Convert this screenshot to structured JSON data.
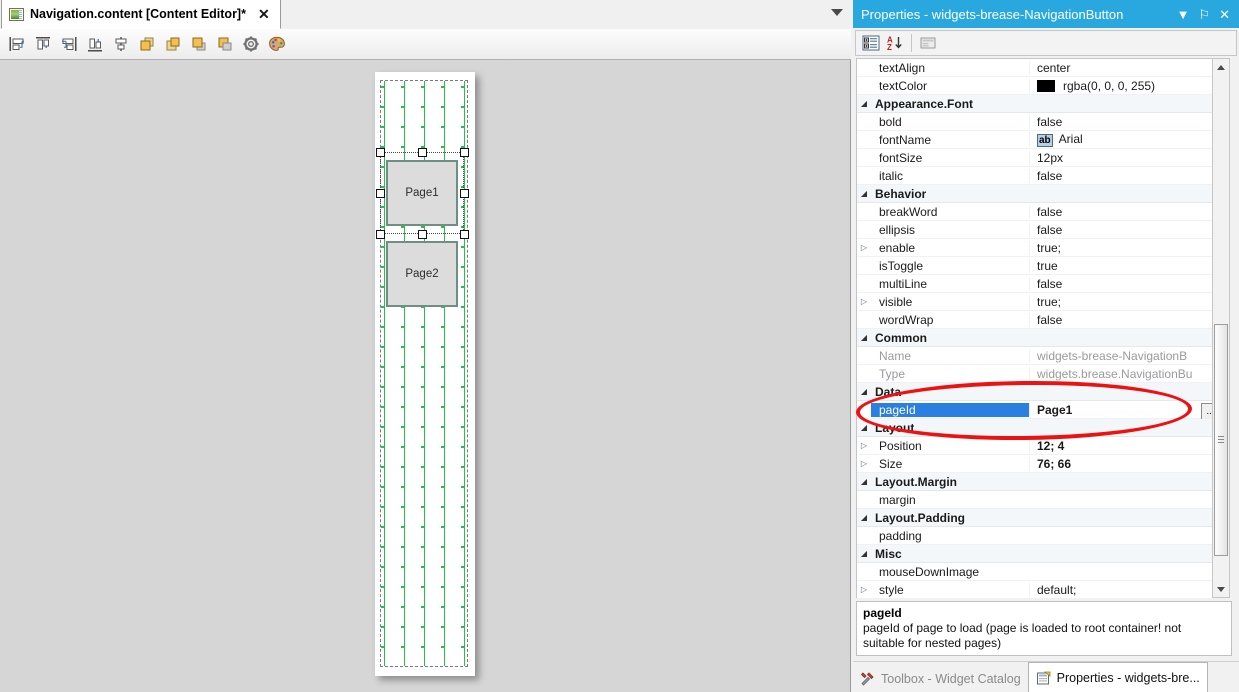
{
  "editor": {
    "tab": {
      "icon": "content-document-icon",
      "title": "Navigation.content [Content Editor]*",
      "close": "✕"
    },
    "tabstrip_dropdown_icon": "chevron-down-icon",
    "toolbar": [
      {
        "name": "align-left-button",
        "label": "Align Left"
      },
      {
        "name": "align-top-button",
        "label": "Align Top"
      },
      {
        "name": "align-right-button",
        "label": "Align Right"
      },
      {
        "name": "align-bottom-button",
        "label": "Align Bottom"
      },
      {
        "name": "align-center-button",
        "label": "Align Center"
      },
      {
        "name": "bring-to-front-button",
        "label": "Bring To Front"
      },
      {
        "name": "send-to-back-button",
        "label": "Send To Back"
      },
      {
        "name": "bring-forward-button",
        "label": "Bring Forward"
      },
      {
        "name": "send-backward-button",
        "label": "Send Backward"
      },
      {
        "name": "settings-gear-button",
        "label": "Settings"
      },
      {
        "name": "palette-button",
        "label": "Theme Palette"
      }
    ],
    "canvas": {
      "widgets": [
        {
          "label": "Page1",
          "selected": true
        },
        {
          "label": "Page2",
          "selected": false
        }
      ]
    }
  },
  "properties": {
    "title": "Properties - widgets-brease-NavigationButton",
    "title_buttons": [
      {
        "name": "panel-menu-icon",
        "glyph": "▼"
      },
      {
        "name": "pin-icon",
        "glyph": "⚐"
      },
      {
        "name": "close-icon",
        "glyph": "✕"
      }
    ],
    "toolbar": [
      {
        "name": "categorized-view-button",
        "label": "Categorized"
      },
      {
        "name": "alphabetical-sort-button",
        "label": "Alphabetical"
      },
      {
        "name": "property-pages-button",
        "label": "Property Pages"
      }
    ],
    "rows": [
      {
        "kind": "prop",
        "name": "textAlign",
        "value": "center"
      },
      {
        "kind": "prop",
        "name": "textColor",
        "value": "rgba(0, 0, 0, 255)",
        "swatch": "#000000"
      },
      {
        "kind": "category",
        "name": "Appearance.Font",
        "value": ""
      },
      {
        "kind": "prop",
        "name": "bold",
        "value": "false"
      },
      {
        "kind": "prop",
        "name": "fontName",
        "value": "Arial",
        "badge": "ab"
      },
      {
        "kind": "prop",
        "name": "fontSize",
        "value": "12px"
      },
      {
        "kind": "prop",
        "name": "italic",
        "value": "false"
      },
      {
        "kind": "category",
        "name": "Behavior",
        "value": ""
      },
      {
        "kind": "prop",
        "name": "breakWord",
        "value": "false"
      },
      {
        "kind": "prop",
        "name": "ellipsis",
        "value": "false"
      },
      {
        "kind": "prop",
        "name": "enable",
        "value": "true;",
        "expandable": true
      },
      {
        "kind": "prop",
        "name": "isToggle",
        "value": "true"
      },
      {
        "kind": "prop",
        "name": "multiLine",
        "value": "false"
      },
      {
        "kind": "prop",
        "name": "visible",
        "value": "true;",
        "expandable": true
      },
      {
        "kind": "prop",
        "name": "wordWrap",
        "value": "false"
      },
      {
        "kind": "category",
        "name": "Common",
        "value": ""
      },
      {
        "kind": "prop",
        "name": "Name",
        "value": "widgets-brease-NavigationB",
        "readonly": true
      },
      {
        "kind": "prop",
        "name": "Type",
        "value": "widgets.brease.NavigationBu",
        "readonly": true
      },
      {
        "kind": "category",
        "name": "Data",
        "value": ""
      },
      {
        "kind": "prop",
        "name": "pageId",
        "value": "Page1",
        "selected": true,
        "bold": true,
        "ellipsis_button": "..."
      },
      {
        "kind": "category",
        "name": "Layout",
        "value": ""
      },
      {
        "kind": "prop",
        "name": "Position",
        "value": "12; 4",
        "expandable": true,
        "bold": true
      },
      {
        "kind": "prop",
        "name": "Size",
        "value": "76; 66",
        "expandable": true,
        "bold": true
      },
      {
        "kind": "category",
        "name": "Layout.Margin",
        "value": ""
      },
      {
        "kind": "prop",
        "name": "margin",
        "value": ""
      },
      {
        "kind": "category",
        "name": "Layout.Padding",
        "value": ""
      },
      {
        "kind": "prop",
        "name": "padding",
        "value": ""
      },
      {
        "kind": "category",
        "name": "Misc",
        "value": ""
      },
      {
        "kind": "prop",
        "name": "mouseDownImage",
        "value": ""
      },
      {
        "kind": "prop",
        "name": "style",
        "value": "default;",
        "expandable": true
      }
    ],
    "description": {
      "title": "pageId",
      "body": "pageId of page to load (page is loaded to root container! not suitable for nested pages)"
    },
    "bottom_tabs": [
      {
        "name": "tab-toolbox-widget-catalog",
        "label": "Toolbox - Widget Catalog",
        "icon": "tools-icon",
        "active": false
      },
      {
        "name": "tab-properties",
        "label": "Properties - widgets-bre...",
        "icon": "properties-icon",
        "active": true
      }
    ]
  },
  "annotation": {
    "shape": "red-ellipse-highlight",
    "color": "#ee1111"
  }
}
